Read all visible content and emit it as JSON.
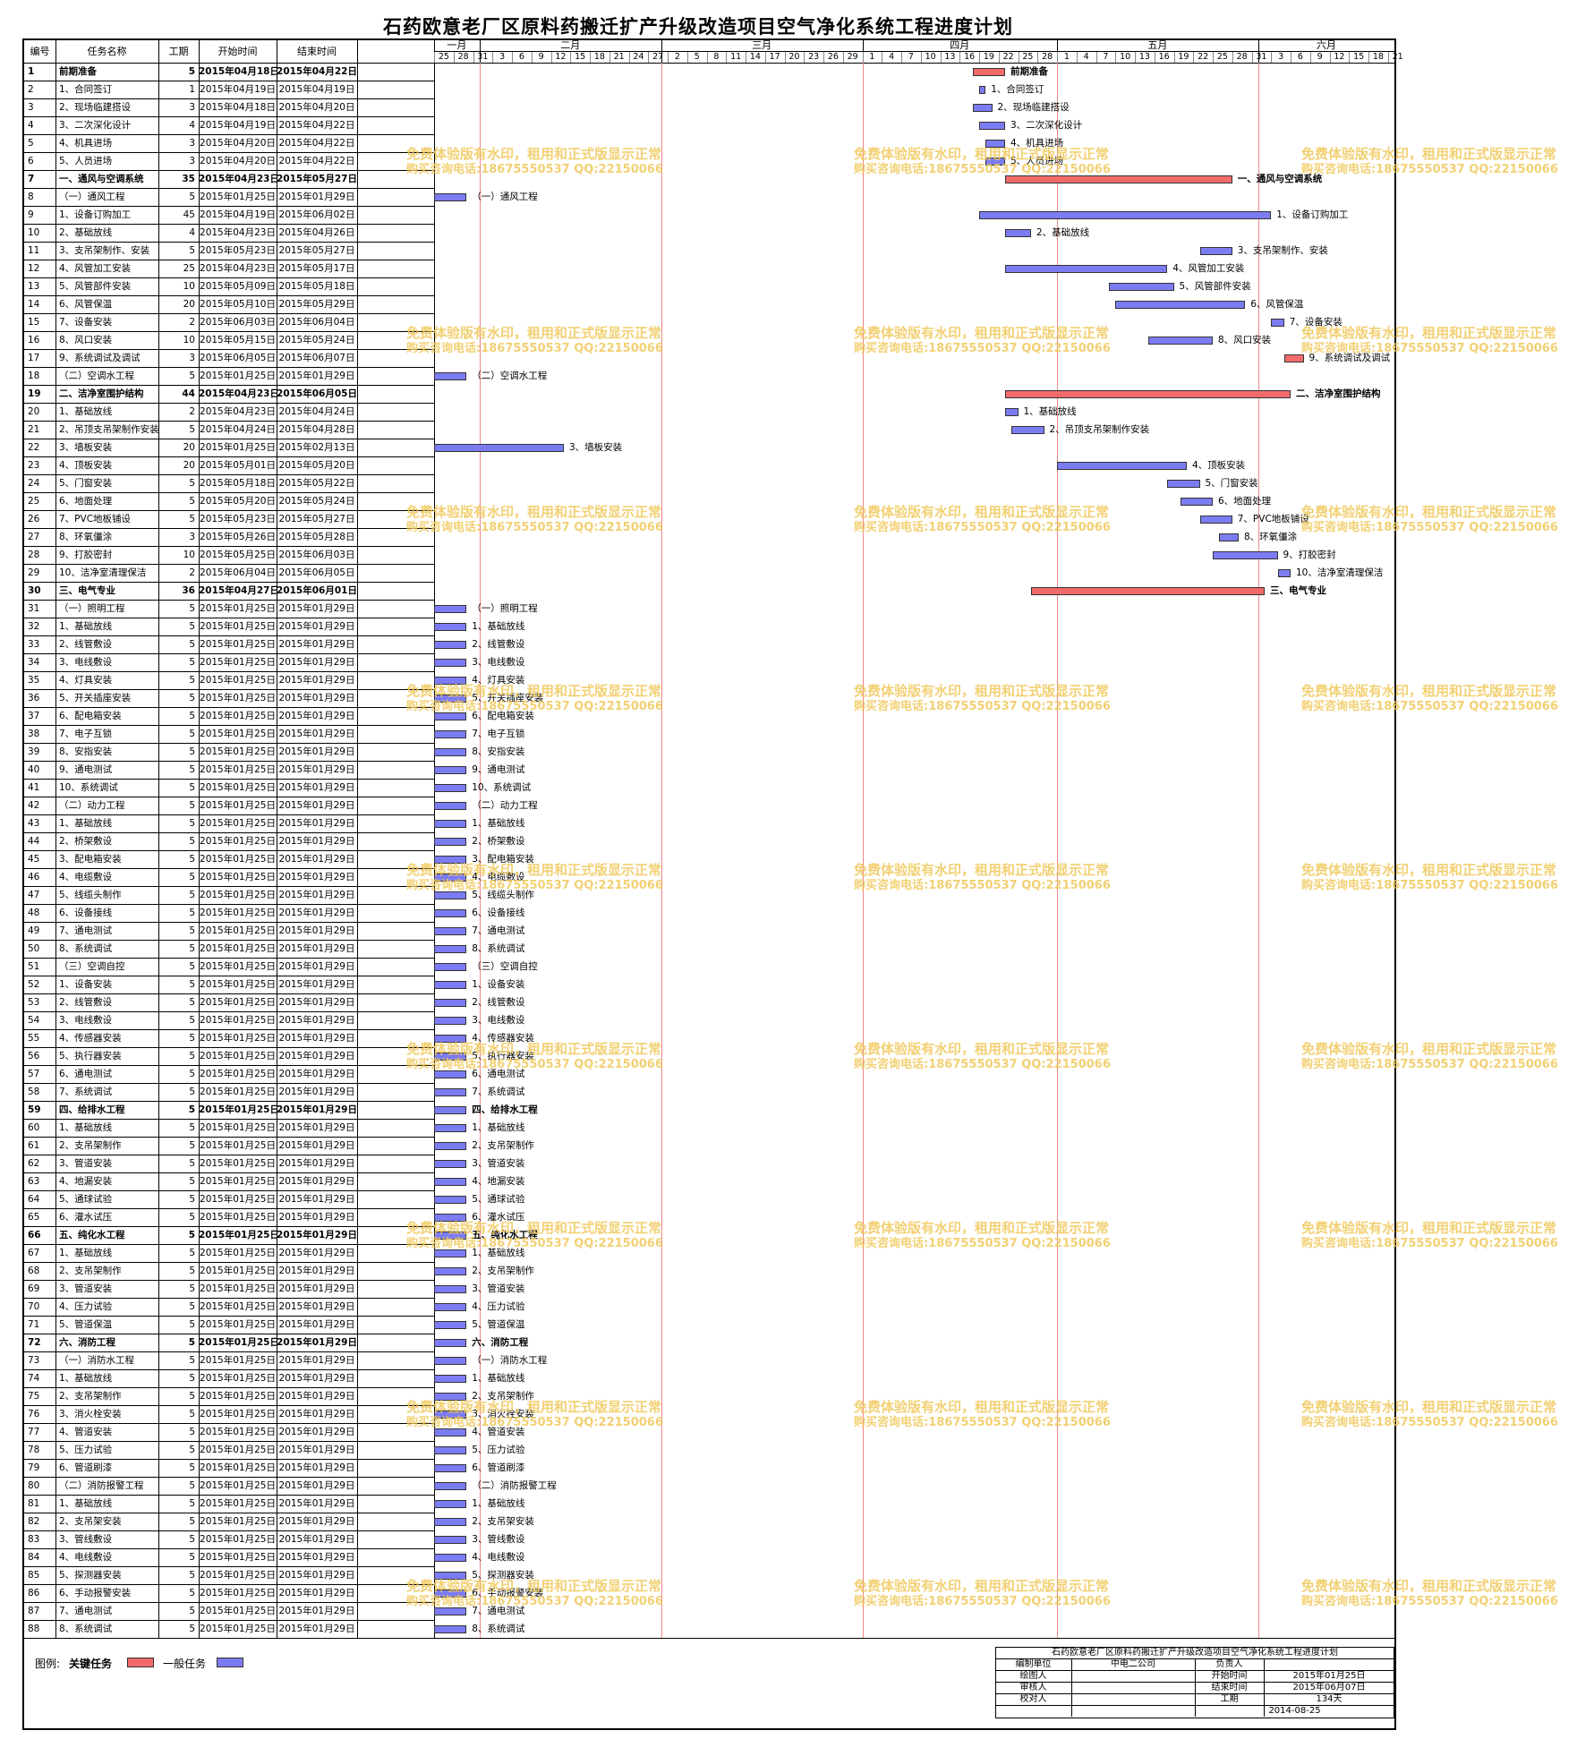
{
  "title": "石药欧意老厂区原料药搬迁扩产升级改造项目空气净化系统工程进度计划",
  "headers": {
    "id": "编号",
    "name": "任务名称",
    "days": "工期",
    "start": "开始时间",
    "end": "结束时间"
  },
  "months": [
    {
      "label": "一月",
      "ticks": [
        "25",
        "28",
        "31"
      ]
    },
    {
      "label": "二月",
      "ticks": [
        "3",
        "6",
        "9",
        "12",
        "15",
        "18",
        "21",
        "24",
        "27"
      ]
    },
    {
      "label": "三月",
      "ticks": [
        "2",
        "5",
        "8",
        "11",
        "14",
        "17",
        "20",
        "23",
        "26",
        "29"
      ]
    },
    {
      "label": "四月",
      "ticks": [
        "1",
        "4",
        "7",
        "10",
        "13",
        "16",
        "19",
        "22",
        "25",
        "28"
      ]
    },
    {
      "label": "五月",
      "ticks": [
        "1",
        "4",
        "7",
        "10",
        "13",
        "16",
        "19",
        "22",
        "25",
        "28",
        "31"
      ]
    },
    {
      "label": "六月",
      "ticks": [
        "3",
        "6",
        "9",
        "12",
        "15",
        "18",
        "21"
      ]
    }
  ],
  "tasks": [
    {
      "id": "1",
      "name": "前期准备",
      "days": "5",
      "start": "2015年04月18日",
      "end": "2015年04月22日",
      "key": true,
      "bold": true
    },
    {
      "id": "2",
      "name": "1、合同签订",
      "days": "1",
      "start": "2015年04月19日",
      "end": "2015年04月19日",
      "key": false
    },
    {
      "id": "3",
      "name": "2、现场临建搭设",
      "days": "3",
      "start": "2015年04月18日",
      "end": "2015年04月20日",
      "key": false
    },
    {
      "id": "4",
      "name": "3、二次深化设计",
      "days": "4",
      "start": "2015年04月19日",
      "end": "2015年04月22日",
      "key": false
    },
    {
      "id": "5",
      "name": "4、机具进场",
      "days": "3",
      "start": "2015年04月20日",
      "end": "2015年04月22日",
      "key": false
    },
    {
      "id": "6",
      "name": "5、人员进场",
      "days": "3",
      "start": "2015年04月20日",
      "end": "2015年04月22日",
      "key": false
    },
    {
      "id": "7",
      "name": "一、通风与空调系统",
      "days": "35",
      "start": "2015年04月23日",
      "end": "2015年05月27日",
      "key": true,
      "bold": true
    },
    {
      "id": "8",
      "name": "（一）通风工程",
      "days": "5",
      "start": "2015年01月25日",
      "end": "2015年01月29日",
      "key": false
    },
    {
      "id": "9",
      "name": "1、设备订购加工",
      "days": "45",
      "start": "2015年04月19日",
      "end": "2015年06月02日",
      "key": false
    },
    {
      "id": "10",
      "name": "2、基础放线",
      "days": "4",
      "start": "2015年04月23日",
      "end": "2015年04月26日",
      "key": false
    },
    {
      "id": "11",
      "name": "3、支吊架制作、安装",
      "days": "5",
      "start": "2015年05月23日",
      "end": "2015年05月27日",
      "key": false
    },
    {
      "id": "12",
      "name": "4、风管加工安装",
      "days": "25",
      "start": "2015年04月23日",
      "end": "2015年05月17日",
      "key": false
    },
    {
      "id": "13",
      "name": "5、风管部件安装",
      "days": "10",
      "start": "2015年05月09日",
      "end": "2015年05月18日",
      "key": false
    },
    {
      "id": "14",
      "name": "6、风管保温",
      "days": "20",
      "start": "2015年05月10日",
      "end": "2015年05月29日",
      "key": false
    },
    {
      "id": "15",
      "name": "7、设备安装",
      "days": "2",
      "start": "2015年06月03日",
      "end": "2015年06月04日",
      "key": false
    },
    {
      "id": "16",
      "name": "8、风口安装",
      "days": "10",
      "start": "2015年05月15日",
      "end": "2015年05月24日",
      "key": false
    },
    {
      "id": "17",
      "name": "9、系统调试及调试",
      "days": "3",
      "start": "2015年06月05日",
      "end": "2015年06月07日",
      "key": true
    },
    {
      "id": "18",
      "name": "（二）空调水工程",
      "days": "5",
      "start": "2015年01月25日",
      "end": "2015年01月29日",
      "key": false
    },
    {
      "id": "19",
      "name": "二、洁净室围护结构",
      "days": "44",
      "start": "2015年04月23日",
      "end": "2015年06月05日",
      "key": true,
      "bold": true
    },
    {
      "id": "20",
      "name": "1、基础放线",
      "days": "2",
      "start": "2015年04月23日",
      "end": "2015年04月24日",
      "key": false
    },
    {
      "id": "21",
      "name": "2、吊顶支吊架制作安装",
      "days": "5",
      "start": "2015年04月24日",
      "end": "2015年04月28日",
      "key": false
    },
    {
      "id": "22",
      "name": "3、墙板安装",
      "days": "20",
      "start": "2015年01月25日",
      "end": "2015年02月13日",
      "key": false
    },
    {
      "id": "23",
      "name": "4、顶板安装",
      "days": "20",
      "start": "2015年05月01日",
      "end": "2015年05月20日",
      "key": false
    },
    {
      "id": "24",
      "name": "5、门窗安装",
      "days": "5",
      "start": "2015年05月18日",
      "end": "2015年05月22日",
      "key": false
    },
    {
      "id": "25",
      "name": "6、地面处理",
      "days": "5",
      "start": "2015年05月20日",
      "end": "2015年05月24日",
      "key": false
    },
    {
      "id": "26",
      "name": "7、PVC地板铺设",
      "days": "5",
      "start": "2015年05月23日",
      "end": "2015年05月27日",
      "key": false
    },
    {
      "id": "27",
      "name": "8、环氧僵涂",
      "days": "3",
      "start": "2015年05月26日",
      "end": "2015年05月28日",
      "key": false
    },
    {
      "id": "28",
      "name": "9、打胶密封",
      "days": "10",
      "start": "2015年05月25日",
      "end": "2015年06月03日",
      "key": false
    },
    {
      "id": "29",
      "name": "10、洁净室清理保洁",
      "days": "2",
      "start": "2015年06月04日",
      "end": "2015年06月05日",
      "key": false
    },
    {
      "id": "30",
      "name": "三、电气专业",
      "days": "36",
      "start": "2015年04月27日",
      "end": "2015年06月01日",
      "key": true,
      "bold": true
    },
    {
      "id": "31",
      "name": "（一）照明工程",
      "days": "5",
      "start": "2015年01月25日",
      "end": "2015年01月29日",
      "key": false
    },
    {
      "id": "32",
      "name": "1、基础放线",
      "days": "5",
      "start": "2015年01月25日",
      "end": "2015年01月29日",
      "key": false
    },
    {
      "id": "33",
      "name": "2、线管敷设",
      "days": "5",
      "start": "2015年01月25日",
      "end": "2015年01月29日",
      "key": false
    },
    {
      "id": "34",
      "name": "3、电线敷设",
      "days": "5",
      "start": "2015年01月25日",
      "end": "2015年01月29日",
      "key": false
    },
    {
      "id": "35",
      "name": "4、灯具安装",
      "days": "5",
      "start": "2015年01月25日",
      "end": "2015年01月29日",
      "key": false
    },
    {
      "id": "36",
      "name": "5、开关插座安装",
      "days": "5",
      "start": "2015年01月25日",
      "end": "2015年01月29日",
      "key": false
    },
    {
      "id": "37",
      "name": "6、配电箱安装",
      "days": "5",
      "start": "2015年01月25日",
      "end": "2015年01月29日",
      "key": false
    },
    {
      "id": "38",
      "name": "7、电子互锁",
      "days": "5",
      "start": "2015年01月25日",
      "end": "2015年01月29日",
      "key": false
    },
    {
      "id": "39",
      "name": "8、安指安装",
      "days": "5",
      "start": "2015年01月25日",
      "end": "2015年01月29日",
      "key": false
    },
    {
      "id": "40",
      "name": "9、通电测试",
      "days": "5",
      "start": "2015年01月25日",
      "end": "2015年01月29日",
      "key": false
    },
    {
      "id": "41",
      "name": "10、系统调试",
      "days": "5",
      "start": "2015年01月25日",
      "end": "2015年01月29日",
      "key": false
    },
    {
      "id": "42",
      "name": "（二）动力工程",
      "days": "5",
      "start": "2015年01月25日",
      "end": "2015年01月29日",
      "key": false
    },
    {
      "id": "43",
      "name": "1、基础放线",
      "days": "5",
      "start": "2015年01月25日",
      "end": "2015年01月29日",
      "key": false
    },
    {
      "id": "44",
      "name": "2、桥架敷设",
      "days": "5",
      "start": "2015年01月25日",
      "end": "2015年01月29日",
      "key": false
    },
    {
      "id": "45",
      "name": "3、配电箱安装",
      "days": "5",
      "start": "2015年01月25日",
      "end": "2015年01月29日",
      "key": false
    },
    {
      "id": "46",
      "name": "4、电缆敷设",
      "days": "5",
      "start": "2015年01月25日",
      "end": "2015年01月29日",
      "key": false
    },
    {
      "id": "47",
      "name": "5、线缆头制作",
      "days": "5",
      "start": "2015年01月25日",
      "end": "2015年01月29日",
      "key": false
    },
    {
      "id": "48",
      "name": "6、设备接线",
      "days": "5",
      "start": "2015年01月25日",
      "end": "2015年01月29日",
      "key": false
    },
    {
      "id": "49",
      "name": "7、通电测试",
      "days": "5",
      "start": "2015年01月25日",
      "end": "2015年01月29日",
      "key": false
    },
    {
      "id": "50",
      "name": "8、系统调试",
      "days": "5",
      "start": "2015年01月25日",
      "end": "2015年01月29日",
      "key": false
    },
    {
      "id": "51",
      "name": "（三）空调自控",
      "days": "5",
      "start": "2015年01月25日",
      "end": "2015年01月29日",
      "key": false
    },
    {
      "id": "52",
      "name": "1、设备安装",
      "days": "5",
      "start": "2015年01月25日",
      "end": "2015年01月29日",
      "key": false
    },
    {
      "id": "53",
      "name": "2、线管敷设",
      "days": "5",
      "start": "2015年01月25日",
      "end": "2015年01月29日",
      "key": false
    },
    {
      "id": "54",
      "name": "3、电线敷设",
      "days": "5",
      "start": "2015年01月25日",
      "end": "2015年01月29日",
      "key": false
    },
    {
      "id": "55",
      "name": "4、传感器安装",
      "days": "5",
      "start": "2015年01月25日",
      "end": "2015年01月29日",
      "key": false
    },
    {
      "id": "56",
      "name": "5、执行器安装",
      "days": "5",
      "start": "2015年01月25日",
      "end": "2015年01月29日",
      "key": false
    },
    {
      "id": "57",
      "name": "6、通电测试",
      "days": "5",
      "start": "2015年01月25日",
      "end": "2015年01月29日",
      "key": false
    },
    {
      "id": "58",
      "name": "7、系统调试",
      "days": "5",
      "start": "2015年01月25日",
      "end": "2015年01月29日",
      "key": false
    },
    {
      "id": "59",
      "name": "四、给排水工程",
      "days": "5",
      "start": "2015年01月25日",
      "end": "2015年01月29日",
      "key": false,
      "bold": true
    },
    {
      "id": "60",
      "name": "1、基础放线",
      "days": "5",
      "start": "2015年01月25日",
      "end": "2015年01月29日",
      "key": false
    },
    {
      "id": "61",
      "name": "2、支吊架制作",
      "days": "5",
      "start": "2015年01月25日",
      "end": "2015年01月29日",
      "key": false
    },
    {
      "id": "62",
      "name": "3、管道安装",
      "days": "5",
      "start": "2015年01月25日",
      "end": "2015年01月29日",
      "key": false
    },
    {
      "id": "63",
      "name": "4、地漏安装",
      "days": "5",
      "start": "2015年01月25日",
      "end": "2015年01月29日",
      "key": false
    },
    {
      "id": "64",
      "name": "5、通球试验",
      "days": "5",
      "start": "2015年01月25日",
      "end": "2015年01月29日",
      "key": false
    },
    {
      "id": "65",
      "name": "6、灌水试压",
      "days": "5",
      "start": "2015年01月25日",
      "end": "2015年01月29日",
      "key": false
    },
    {
      "id": "66",
      "name": "五、纯化水工程",
      "days": "5",
      "start": "2015年01月25日",
      "end": "2015年01月29日",
      "key": false,
      "bold": true
    },
    {
      "id": "67",
      "name": "1、基础放线",
      "days": "5",
      "start": "2015年01月25日",
      "end": "2015年01月29日",
      "key": false
    },
    {
      "id": "68",
      "name": "2、支吊架制作",
      "days": "5",
      "start": "2015年01月25日",
      "end": "2015年01月29日",
      "key": false
    },
    {
      "id": "69",
      "name": "3、管道安装",
      "days": "5",
      "start": "2015年01月25日",
      "end": "2015年01月29日",
      "key": false
    },
    {
      "id": "70",
      "name": "4、压力试验",
      "days": "5",
      "start": "2015年01月25日",
      "end": "2015年01月29日",
      "key": false
    },
    {
      "id": "71",
      "name": "5、管道保温",
      "days": "5",
      "start": "2015年01月25日",
      "end": "2015年01月29日",
      "key": false
    },
    {
      "id": "72",
      "name": "六、消防工程",
      "days": "5",
      "start": "2015年01月25日",
      "end": "2015年01月29日",
      "key": false,
      "bold": true
    },
    {
      "id": "73",
      "name": "（一）消防水工程",
      "days": "5",
      "start": "2015年01月25日",
      "end": "2015年01月29日",
      "key": false
    },
    {
      "id": "74",
      "name": "1、基础放线",
      "days": "5",
      "start": "2015年01月25日",
      "end": "2015年01月29日",
      "key": false
    },
    {
      "id": "75",
      "name": "2、支吊架制作",
      "days": "5",
      "start": "2015年01月25日",
      "end": "2015年01月29日",
      "key": false
    },
    {
      "id": "76",
      "name": "3、消火栓安装",
      "days": "5",
      "start": "2015年01月25日",
      "end": "2015年01月29日",
      "key": false
    },
    {
      "id": "77",
      "name": "4、管道安装",
      "days": "5",
      "start": "2015年01月25日",
      "end": "2015年01月29日",
      "key": false
    },
    {
      "id": "78",
      "name": "5、压力试验",
      "days": "5",
      "start": "2015年01月25日",
      "end": "2015年01月29日",
      "key": false
    },
    {
      "id": "79",
      "name": "6、管道刷漆",
      "days": "5",
      "start": "2015年01月25日",
      "end": "2015年01月29日",
      "key": false
    },
    {
      "id": "80",
      "name": "（二）消防报警工程",
      "days": "5",
      "start": "2015年01月25日",
      "end": "2015年01月29日",
      "key": false
    },
    {
      "id": "81",
      "name": "1、基础放线",
      "days": "5",
      "start": "2015年01月25日",
      "end": "2015年01月29日",
      "key": false
    },
    {
      "id": "82",
      "name": "2、支吊架安装",
      "days": "5",
      "start": "2015年01月25日",
      "end": "2015年01月29日",
      "key": false
    },
    {
      "id": "83",
      "name": "3、管线敷设",
      "days": "5",
      "start": "2015年01月25日",
      "end": "2015年01月29日",
      "key": false
    },
    {
      "id": "84",
      "name": "4、电线敷设",
      "days": "5",
      "start": "2015年01月25日",
      "end": "2015年01月29日",
      "key": false
    },
    {
      "id": "85",
      "name": "5、探测器安装",
      "days": "5",
      "start": "2015年01月25日",
      "end": "2015年01月29日",
      "key": false
    },
    {
      "id": "86",
      "name": "6、手动报警安装",
      "days": "5",
      "start": "2015年01月25日",
      "end": "2015年01月29日",
      "key": false
    },
    {
      "id": "87",
      "name": "7、通电测试",
      "days": "5",
      "start": "2015年01月25日",
      "end": "2015年01月29日",
      "key": false
    },
    {
      "id": "88",
      "name": "8、系统调试",
      "days": "5",
      "start": "2015年01月25日",
      "end": "2015年01月29日",
      "key": false
    }
  ],
  "legend": {
    "label": "图例:",
    "key_label": "关键任务",
    "normal_label": "一般任务",
    "key_color": "#f26b6b",
    "normal_color": "#7c7cf2"
  },
  "watermark": {
    "line1": "免费体验版有水印，租用和正式版显示正常",
    "line2": "购买咨询电话:18675550537 QQ:22150066"
  },
  "footer": {
    "title": "石药欧意老厂区原料药搬迁扩产升级改造项目空气净化系统工程进度计划",
    "unit_label": "编制单位",
    "unit": "中电二公司",
    "owner_label": "负责人",
    "owner": "",
    "drafter_label": "绘图人",
    "drafter": "",
    "start_label": "开始时间",
    "start": "2015年01月25日",
    "reviewer_label": "审核人",
    "reviewer": "",
    "end_label": "结束时间",
    "end": "2015年06月07日",
    "checker_label": "校对人",
    "checker": "",
    "period_label": "工期",
    "period": "134天",
    "date": "2014-08-25"
  }
}
